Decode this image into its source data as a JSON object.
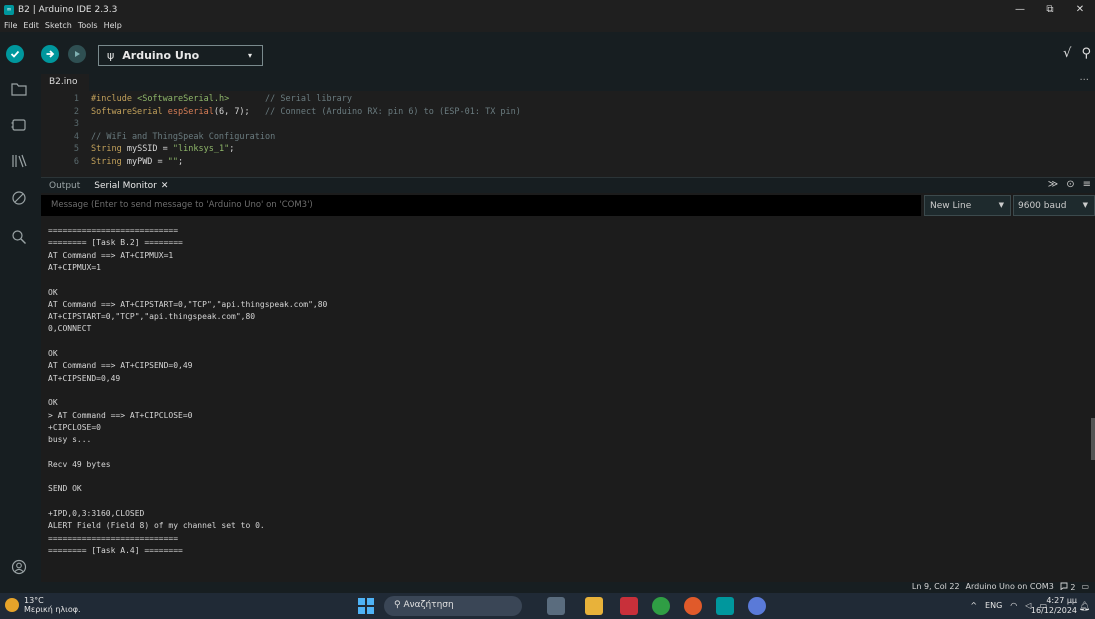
{
  "window": {
    "title": "B2 | Arduino IDE 2.3.3",
    "minimize": "—",
    "maximize": "⧉",
    "close": "✕"
  },
  "menu": [
    "File",
    "Edit",
    "Sketch",
    "Tools",
    "Help"
  ],
  "toolbar": {
    "board": "Arduino Uno",
    "usb_glyph": "ψ",
    "caret": "▾",
    "serial_plotter_glyph": "√",
    "serial_monitor_glyph": "⚲"
  },
  "editor": {
    "tab": "B2.ino",
    "more": "···",
    "lines": [
      {
        "n": "1",
        "parts": [
          [
            "kw",
            "#include"
          ],
          [
            "tx",
            " "
          ],
          [
            "str",
            "<SoftwareSerial.h>"
          ],
          [
            "tx",
            "       "
          ],
          [
            "cm",
            "// Serial library"
          ]
        ]
      },
      {
        "n": "2",
        "parts": [
          [
            "ty",
            "SoftwareSerial"
          ],
          [
            "tx",
            " "
          ],
          [
            "fn",
            "espSerial"
          ],
          [
            "tx",
            "(6, 7);   "
          ],
          [
            "cm",
            "// Connect (Arduino RX: pin 6) to (ESP-01: TX pin)"
          ]
        ]
      },
      {
        "n": "3",
        "parts": []
      },
      {
        "n": "4",
        "parts": [
          [
            "cm",
            "// WiFi and ThingSpeak Configuration"
          ]
        ]
      },
      {
        "n": "5",
        "parts": [
          [
            "ty",
            "String"
          ],
          [
            "tx",
            " mySSID = "
          ],
          [
            "str",
            "\"linksys_1\""
          ],
          [
            "tx",
            ";"
          ]
        ]
      },
      {
        "n": "6",
        "parts": [
          [
            "ty",
            "String"
          ],
          [
            "tx",
            " myPWD = "
          ],
          [
            "str",
            "\"\""
          ],
          [
            "tx",
            ";"
          ]
        ]
      }
    ]
  },
  "panel": {
    "output_tab": "Output",
    "serial_tab": "Serial Monitor",
    "close_glyph": "✕",
    "message_placeholder": "Message (Enter to send message to 'Arduino Uno' on 'COM3')",
    "line_ending": "New Line",
    "baud": "9600 baud",
    "caret": "▼",
    "icons": [
      "≫",
      "⊙",
      "≡"
    ]
  },
  "serial_output": [
    "===========================",
    "======== [Task B.2] ========",
    "AT Command ==> AT+CIPMUX=1",
    "AT+CIPMUX=1",
    "",
    "OK",
    "AT Command ==> AT+CIPSTART=0,\"TCP\",\"api.thingspeak.com\",80",
    "AT+CIPSTART=0,\"TCP\",\"api.thingspeak.com\",80",
    "0,CONNECT",
    "",
    "OK",
    "AT Command ==> AT+CIPSEND=0,49",
    "AT+CIPSEND=0,49",
    "",
    "OK",
    "> AT Command ==> AT+CIPCLOSE=0",
    "+CIPCLOSE=0",
    "busy s...",
    "",
    "Recv 49 bytes",
    "",
    "SEND OK",
    "",
    "+IPD,0,3:3160,CLOSED",
    "ALERT Field (Field 8) of my channel set to 0.",
    "===========================",
    "======== [Task A.4] ========"
  ],
  "status": {
    "position": "Ln 9, Col 22",
    "board_port": "Arduino Uno on COM3",
    "notifications": "2"
  },
  "taskbar": {
    "temp": "13°C",
    "weather": "Μερική ηλιοφ.",
    "search": "Αναζήτηση",
    "tray_arrow": "^",
    "lang": "ENG",
    "time": "4:27 μμ",
    "date": "16/12/2024"
  },
  "colors": {
    "accent": "#00979d",
    "toolbar_bg": "#171e21",
    "editor_bg": "#1e1e1e",
    "taskbar_bg": "#202a36"
  }
}
